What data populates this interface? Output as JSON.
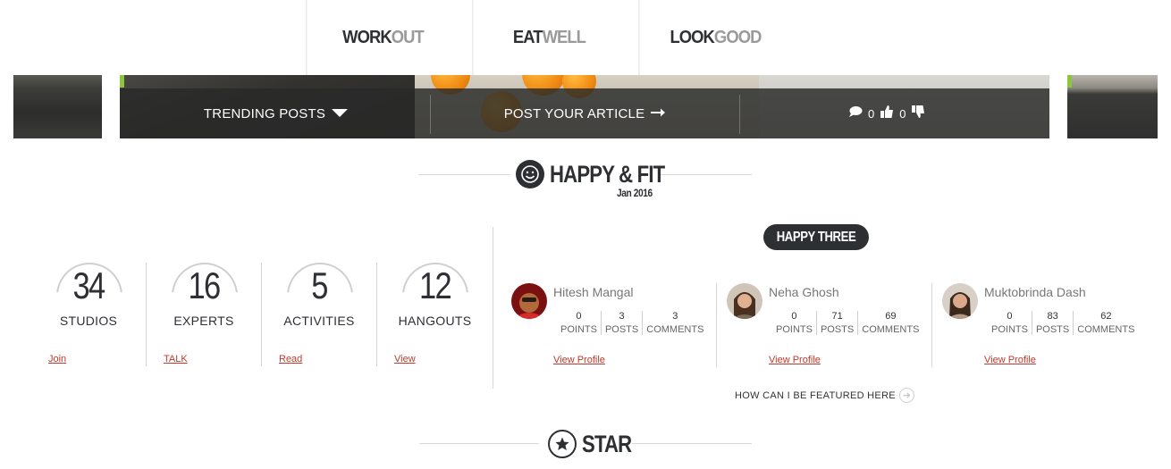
{
  "nav": {
    "tabs": [
      {
        "dark": "WORK",
        "light": "OUT"
      },
      {
        "dark": "EAT",
        "light": "WELL"
      },
      {
        "dark": "LOOK",
        "light": "GOOD"
      }
    ]
  },
  "banner": {
    "trending_label": "TRENDING POSTS",
    "post_label": "POST YOUR ARTICLE",
    "comments_count": "0",
    "likes_count": "0"
  },
  "section": {
    "title": "HAPPY & FIT",
    "subtitle": "Jan 2016",
    "next_title": "STAR"
  },
  "stats": [
    {
      "value": "34",
      "label": "STUDIOS",
      "link": "Join"
    },
    {
      "value": "16",
      "label": "EXPERTS",
      "link": "TALK"
    },
    {
      "value": "5",
      "label": "ACTIVITIES",
      "link": "Read"
    },
    {
      "value": "12",
      "label": "HANGOUTS",
      "link": "View"
    }
  ],
  "happy_three": {
    "title": "HAPPY THREE",
    "stat_labels": {
      "points": "POINTS",
      "posts": "POSTS",
      "comments": "COMMENTS"
    },
    "view_label": "View Profile",
    "featured_label": "HOW CAN I BE FEATURED HERE",
    "people": [
      {
        "name": "Hitesh Mangal",
        "points": "0",
        "posts": "3",
        "comments": "3"
      },
      {
        "name": "Neha Ghosh",
        "points": "0",
        "posts": "71",
        "comments": "69"
      },
      {
        "name": "Muktobrinda Dash",
        "points": "0",
        "posts": "83",
        "comments": "62"
      }
    ]
  },
  "colors": {
    "dark": "#2d2f33",
    "link_red": "#c0392b",
    "accent_green": "#8cc63f"
  },
  "icons": {
    "trending_arrow": "caret-down-icon",
    "post_arrow": "arrow-right-icon",
    "comment": "comment-icon",
    "like": "thumbs-up-icon",
    "dislike": "thumbs-down-icon",
    "happy": "smiley-icon",
    "star": "star-icon",
    "featured_go": "arrow-circle-icon"
  }
}
